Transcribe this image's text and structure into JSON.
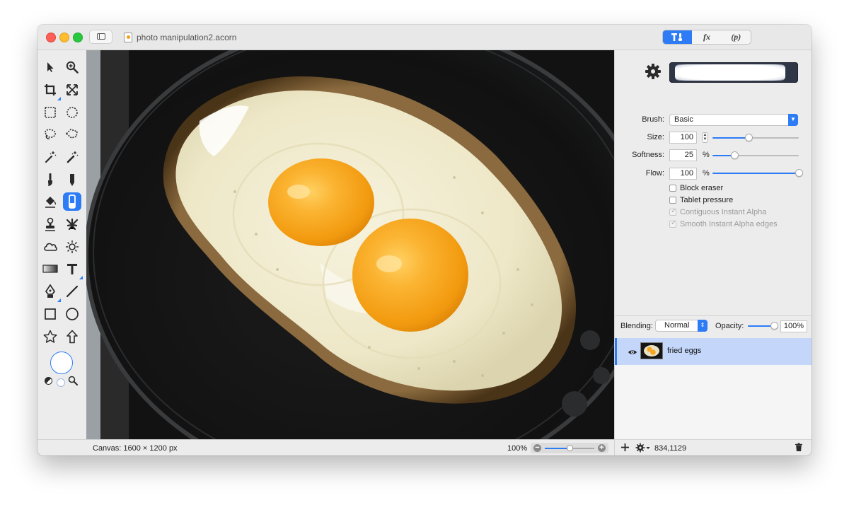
{
  "window": {
    "title": "photo manipulation2.acorn"
  },
  "segments": [
    {
      "label": "T",
      "name": "tool-palette-tab"
    },
    {
      "label": "fx",
      "name": "filters-tab"
    },
    {
      "label": "(p)",
      "name": "presets-tab"
    }
  ],
  "tools": [
    {
      "name": "select-arrow-icon"
    },
    {
      "name": "zoom-icon"
    },
    {
      "name": "crop-icon"
    },
    {
      "name": "transform-icon"
    },
    {
      "name": "rect-select-icon"
    },
    {
      "name": "ellipse-select-icon"
    },
    {
      "name": "lasso-icon"
    },
    {
      "name": "polygon-lasso-icon"
    },
    {
      "name": "magic-wand-icon"
    },
    {
      "name": "magic-wand-color-icon"
    },
    {
      "name": "brush-icon"
    },
    {
      "name": "pencil-icon"
    },
    {
      "name": "paint-bucket-icon"
    },
    {
      "name": "eraser-icon"
    },
    {
      "name": "clone-stamp-icon"
    },
    {
      "name": "smudge-icon"
    },
    {
      "name": "cloud-icon"
    },
    {
      "name": "sun-icon"
    },
    {
      "name": "gradient-icon"
    },
    {
      "name": "text-icon"
    },
    {
      "name": "pen-icon"
    },
    {
      "name": "line-icon"
    },
    {
      "name": "rectangle-icon"
    },
    {
      "name": "oval-icon"
    },
    {
      "name": "star-icon"
    },
    {
      "name": "arrow-icon"
    }
  ],
  "colors": {
    "accent": "#2d7cf6",
    "foreground_swatch": "#ffffff"
  },
  "status": {
    "canvas_info": "Canvas: 1600 × 1200 px",
    "zoom": "100%",
    "zoom_level": 0.5
  },
  "brush_settings": {
    "brush_label": "Brush:",
    "brush_value": "Basic",
    "size_label": "Size:",
    "size_value": "100",
    "size_level": 0.42,
    "softness_label": "Softness:",
    "softness_value": "25",
    "softness_unit": "%",
    "softness_level": 0.25,
    "flow_label": "Flow:",
    "flow_value": "100",
    "flow_unit": "%",
    "flow_level": 1.0,
    "checkboxes": [
      {
        "label": "Block eraser",
        "checked": false,
        "enabled": true
      },
      {
        "label": "Tablet pressure",
        "checked": false,
        "enabled": true
      },
      {
        "label": "Contiguous Instant Alpha",
        "checked": true,
        "enabled": false
      },
      {
        "label": "Smooth Instant Alpha edges",
        "checked": true,
        "enabled": false
      }
    ]
  },
  "layers": {
    "blending_label": "Blending:",
    "blending_value": "Normal",
    "opacity_label": "Opacity:",
    "opacity_value": "100%",
    "opacity_level": 1.0,
    "items": [
      {
        "name": "fried eggs",
        "visible": true,
        "selected": true
      }
    ]
  },
  "inspector_bottom": {
    "coords": "834,1129"
  }
}
